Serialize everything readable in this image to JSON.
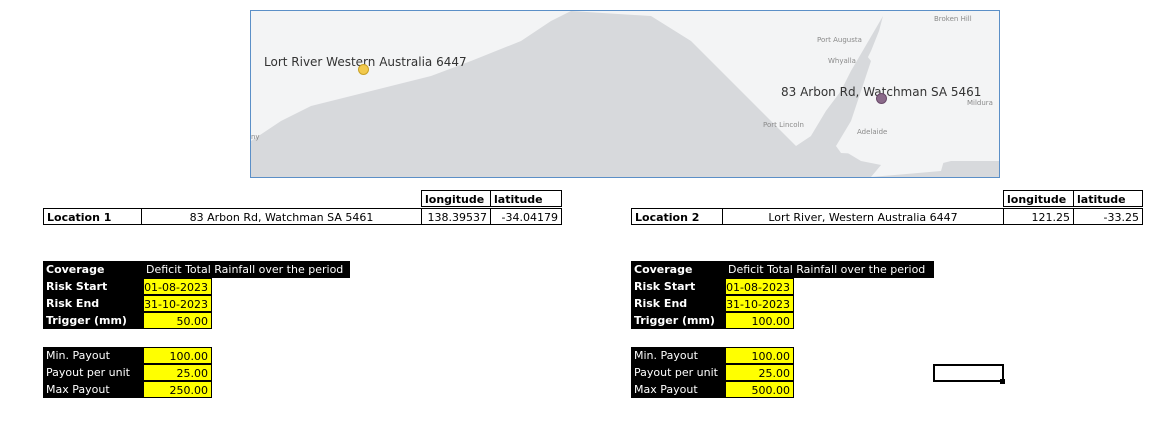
{
  "map": {
    "place_labels": {
      "broken_hill": "Broken Hill",
      "port_augusta": "Port Augusta",
      "whyalla": "Whyalla",
      "mildura": "Mildura",
      "port_lincoln": "Port Lincoln",
      "adelaide": "Adelaide",
      "ny": "ny"
    },
    "marker1_label": "Lort River Western Australia 6447",
    "marker2_label": "83 Arbon Rd, Watchman SA 5461",
    "marker1_color": "#f2c94c",
    "marker2_color": "#8a6a8a"
  },
  "loc1": {
    "col_longitude": "longitude",
    "col_latitude": "latitude",
    "label": "Location 1",
    "address": "83 Arbon Rd, Watchman SA 5461",
    "longitude": "138.39537",
    "latitude": "-34.04179"
  },
  "loc2": {
    "col_longitude": "longitude",
    "col_latitude": "latitude",
    "label": "Location 2",
    "address": "Lort River, Western Australia 6447",
    "longitude": "121.25",
    "latitude": "-33.25"
  },
  "params1": {
    "coverage_label": "Coverage",
    "coverage_value": "Deficit Total Rainfall over the period",
    "risk_start_label": "Risk Start",
    "risk_start": "01-08-2023",
    "risk_end_label": "Risk End",
    "risk_end": "31-10-2023",
    "trigger_label": "Trigger (mm)",
    "trigger": "50.00",
    "min_payout_label": "Min. Payout",
    "min_payout": "100.00",
    "payout_unit_label": "Payout per unit",
    "payout_unit": "25.00",
    "max_payout_label": "Max Payout",
    "max_payout": "250.00"
  },
  "params2": {
    "coverage_label": "Coverage",
    "coverage_value": "Deficit Total Rainfall over the period",
    "risk_start_label": "Risk Start",
    "risk_start": "01-08-2023",
    "risk_end_label": "Risk End",
    "risk_end": "31-10-2023",
    "trigger_label": "Trigger (mm)",
    "trigger": "100.00",
    "min_payout_label": "Min. Payout",
    "min_payout": "100.00",
    "payout_unit_label": "Payout per unit",
    "payout_unit": "25.00",
    "max_payout_label": "Max Payout",
    "max_payout": "500.00"
  }
}
